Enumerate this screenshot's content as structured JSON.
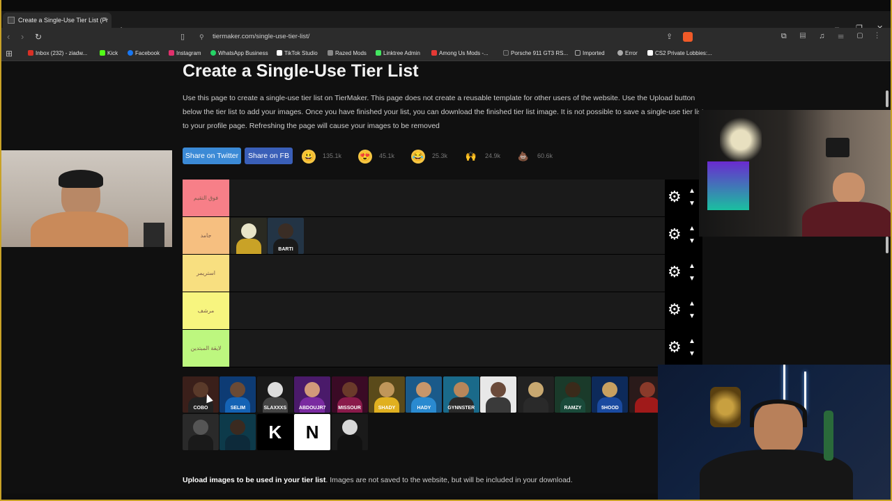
{
  "browser": {
    "tab_title": "Create a Single-Use Tier List (Fr",
    "tab_close": "×",
    "new_tab": "+",
    "window_controls": [
      "–",
      "❐",
      "✕"
    ],
    "url": "tiermaker.com/single-use-tier-list/",
    "toolbar_icons": "⧉ ▤ ♫ ☰ ▢ ⋮",
    "bookmarks": [
      {
        "label": "Inbox (232) - ziadw...",
        "color": "#d93025"
      },
      {
        "label": "Kick",
        "color": "#53fc18"
      },
      {
        "label": "Facebook",
        "color": "#1877f2"
      },
      {
        "label": "Instagram",
        "color": "#e1306c"
      },
      {
        "label": "WhatsApp Business",
        "color": "#25d366"
      },
      {
        "label": "TikTok Studio",
        "color": "#ffffff"
      },
      {
        "label": "Razed Mods",
        "color": "#888888"
      },
      {
        "label": "Linktree Admin",
        "color": "#43e660"
      },
      {
        "label": "Among Us Mods -...",
        "color": "#e53935"
      },
      {
        "label": "Porsche 911 GT3 RS...",
        "color": "#333333"
      },
      {
        "label": "Imported",
        "color": "#aaaaaa"
      },
      {
        "label": "Error",
        "color": "#aaaaaa"
      },
      {
        "label": "CS2 Private Lobbies:...",
        "color": "#ffffff"
      }
    ]
  },
  "page": {
    "title": "Create a Single-Use Tier List",
    "intro": "Use this page to create a single-use tier list on TierMaker. This page does not create a reusable template for other users of the website. Use the Upload button below the tier list to add your images. Once you have finished your list, you can download the finished tier list image. It is not possible to save a single-use tier list to your profile page. Refreshing the page will cause your images to be removed",
    "share_twitter": "Share on Twitter",
    "share_fb": "Share on FB",
    "reactions": [
      {
        "icon": "grin-emoji-icon",
        "glyph": "😃",
        "count": "135.1k"
      },
      {
        "icon": "heart-eyes-emoji-icon",
        "glyph": "😍",
        "count": "45.1k"
      },
      {
        "icon": "laugh-emoji-icon",
        "glyph": "😂",
        "count": "25.3k"
      },
      {
        "icon": "raised-hands-emoji-icon",
        "glyph": "🙌",
        "count": "24.9k"
      },
      {
        "icon": "poop-emoji-icon",
        "glyph": "💩",
        "count": "60.6k"
      }
    ],
    "upload_bold": "Upload images to be used in your tier list",
    "upload_rest": ". Images are not saved to the website, but will be included in your download."
  },
  "tiers": [
    {
      "label": "فوق التقيم",
      "color": "#f77f88",
      "items": 0
    },
    {
      "label": "جامد",
      "color": "#f6bf80",
      "items": 2
    },
    {
      "label": "استريمر",
      "color": "#f8df80",
      "items": 0
    },
    {
      "label": "مرشف",
      "color": "#f7f57f",
      "items": 0
    },
    {
      "label": "لايقة المبتدين",
      "color": "#bdf77f",
      "items": 0
    }
  ],
  "tier_controls": {
    "gear": "⚙",
    "up": "▲",
    "down": "▼"
  },
  "tier_items": {
    "row1": [
      {
        "name": "bear-logo-thumb",
        "bg": "#2a2a22",
        "head": "#e8e4c8",
        "body": "#c9a227",
        "tag": ""
      },
      {
        "name": "barti-thumb",
        "bg": "#233445",
        "head": "#3a2d25",
        "body": "#1a1a1a",
        "tag": "BARTI"
      }
    ]
  },
  "pool_items": [
    {
      "name": "pool-thumb-1",
      "bg": "#3a1f1a",
      "head": "#5a3a2a",
      "body": "#222",
      "tag": "COBO"
    },
    {
      "name": "pool-thumb-2",
      "bg": "#0d3b74",
      "head": "#6a4a35",
      "body": "#1563b5",
      "tag": "SELIM"
    },
    {
      "name": "pool-thumb-3",
      "bg": "#1a1a1a",
      "head": "#dddddd",
      "body": "#444",
      "tag": "SLAXXXS"
    },
    {
      "name": "pool-thumb-4",
      "bg": "#4a1a6a",
      "head": "#d29a7a",
      "body": "#7a2aa0",
      "tag": "ABDOUJR7"
    },
    {
      "name": "pool-thumb-5",
      "bg": "#3a0a25",
      "head": "#6a3a2a",
      "body": "#8a1a4a",
      "tag": "MISSOUR"
    },
    {
      "name": "pool-thumb-6",
      "bg": "#5a4a1a",
      "head": "#c0965a",
      "body": "#e0b020",
      "tag": "SHADY"
    },
    {
      "name": "pool-thumb-7",
      "bg": "#1a5a8a",
      "head": "#c8966a",
      "body": "#2a8ad0",
      "tag": "HADY"
    },
    {
      "name": "pool-thumb-8",
      "bg": "#1a6a8a",
      "head": "#b8865a",
      "body": "#2a2a2a",
      "tag": "GYNNSTER"
    },
    {
      "name": "pool-thumb-9",
      "bg": "#e8e8e8",
      "head": "#6a4a3a",
      "body": "#3a3a3a",
      "tag": ""
    },
    {
      "name": "pool-thumb-10",
      "bg": "#222222",
      "head": "#c8a870",
      "body": "#2a2a2a",
      "tag": ""
    },
    {
      "name": "pool-thumb-11",
      "bg": "#1a3a2a",
      "head": "#3a2a1a",
      "body": "#1a4a3a",
      "tag": "RAMZY"
    },
    {
      "name": "pool-thumb-12",
      "bg": "#0d2a5a",
      "head": "#c8a060",
      "body": "#1a4aa0",
      "tag": "5HOOD"
    },
    {
      "name": "pool-thumb-13",
      "bg": "#2a1a1a",
      "head": "#8a3a2a",
      "body": "#a01a1a",
      "tag": ""
    },
    {
      "name": "pool-thumb-14",
      "bg": "#2a2a2a",
      "head": "#555555",
      "body": "#1a1a1a",
      "tag": ""
    },
    {
      "name": "pool-thumb-15",
      "bg": "#0d3a4a",
      "head": "#3a2a20",
      "body": "#0d2a3a",
      "tag": ""
    },
    {
      "name": "pool-thumb-16",
      "bg": "#000000",
      "head": "#000000",
      "body": "#000000",
      "tag": "K"
    },
    {
      "name": "pool-thumb-17",
      "bg": "#ffffff",
      "head": "#ffffff",
      "body": "#ffffff",
      "tag": "N"
    },
    {
      "name": "pool-thumb-18",
      "bg": "#1a1a1a",
      "head": "#d8d8d8",
      "body": "#111",
      "tag": ""
    }
  ]
}
